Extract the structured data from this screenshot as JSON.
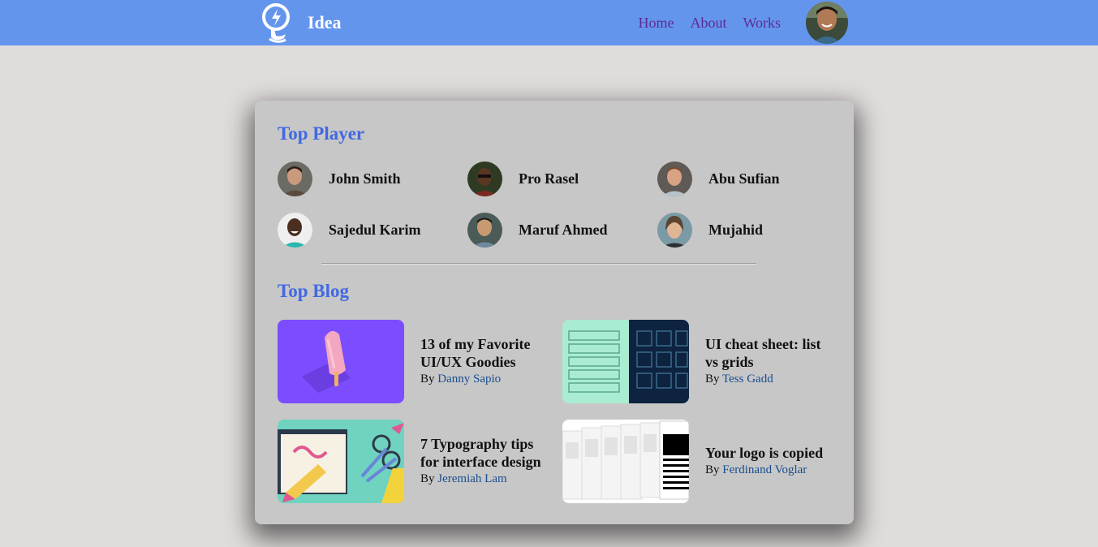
{
  "header": {
    "brand": "Idea",
    "nav": [
      "Home",
      "About",
      "Works"
    ],
    "colors": {
      "bar": "#6495ed",
      "nav_link": "#5b2c97"
    }
  },
  "top_player": {
    "title": "Top Player",
    "players": [
      {
        "name": "John Smith",
        "icon": "player-avatar"
      },
      {
        "name": "Pro Rasel",
        "icon": "player-avatar"
      },
      {
        "name": "Abu Sufian",
        "icon": "player-avatar"
      },
      {
        "name": "Sajedul Karim",
        "icon": "player-avatar"
      },
      {
        "name": "Maruf Ahmed",
        "icon": "player-avatar"
      },
      {
        "name": "Mujahid",
        "icon": "player-avatar"
      }
    ]
  },
  "top_blog": {
    "title": "Top Blog",
    "by": "By",
    "posts": [
      {
        "title": "13 of my Favorite UI/UX Goodies",
        "author": "Danny Sapio"
      },
      {
        "title": "UI cheat sheet: list vs grids",
        "author": "Tess Gadd"
      },
      {
        "title": "7 Typography tips for interface design",
        "author": "Jeremiah Lam"
      },
      {
        "title": "Your logo is copied",
        "author": "Ferdinand Voglar"
      }
    ]
  }
}
